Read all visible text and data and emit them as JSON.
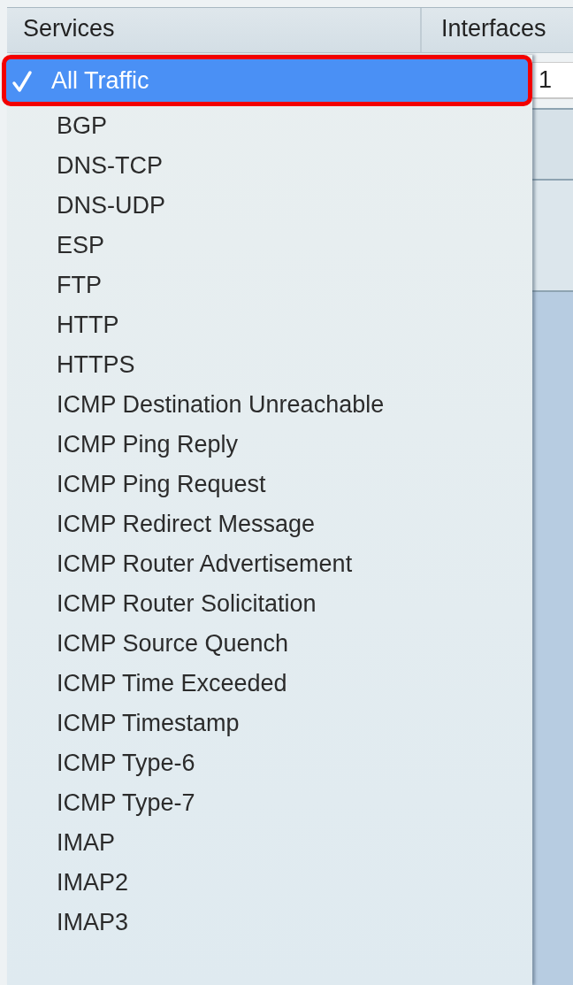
{
  "table": {
    "columns": [
      "Services",
      "Interfaces"
    ],
    "rows": [
      {
        "interface_value": "1"
      }
    ]
  },
  "services_dropdown": {
    "items": [
      {
        "label": "All Traffic",
        "selected": true
      },
      {
        "label": "BGP",
        "selected": false
      },
      {
        "label": "DNS-TCP",
        "selected": false
      },
      {
        "label": "DNS-UDP",
        "selected": false
      },
      {
        "label": "ESP",
        "selected": false
      },
      {
        "label": "FTP",
        "selected": false
      },
      {
        "label": "HTTP",
        "selected": false
      },
      {
        "label": "HTTPS",
        "selected": false
      },
      {
        "label": "ICMP Destination Unreachable",
        "selected": false
      },
      {
        "label": "ICMP Ping Reply",
        "selected": false
      },
      {
        "label": "ICMP Ping Request",
        "selected": false
      },
      {
        "label": "ICMP Redirect Message",
        "selected": false
      },
      {
        "label": "ICMP Router Advertisement",
        "selected": false
      },
      {
        "label": "ICMP Router Solicitation",
        "selected": false
      },
      {
        "label": "ICMP Source Quench",
        "selected": false
      },
      {
        "label": "ICMP Time Exceeded",
        "selected": false
      },
      {
        "label": "ICMP Timestamp",
        "selected": false
      },
      {
        "label": "ICMP Type-6",
        "selected": false
      },
      {
        "label": "ICMP Type-7",
        "selected": false
      },
      {
        "label": "IMAP",
        "selected": false
      },
      {
        "label": "IMAP2",
        "selected": false
      },
      {
        "label": "IMAP3",
        "selected": false
      }
    ]
  }
}
